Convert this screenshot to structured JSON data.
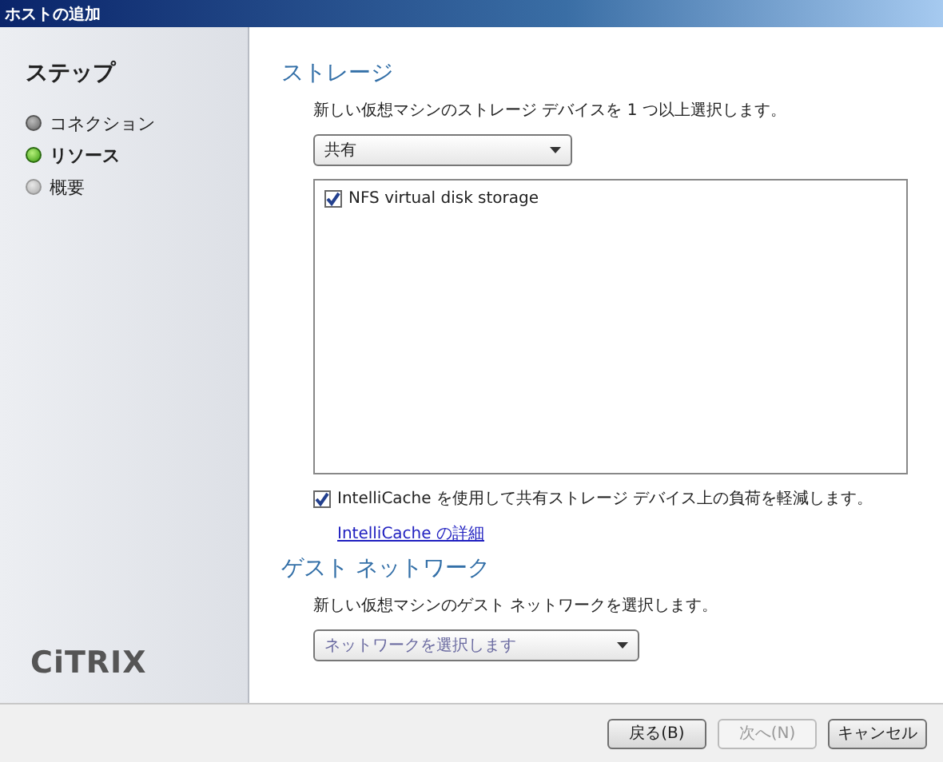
{
  "window": {
    "title": "ホストの追加"
  },
  "sidebar": {
    "heading": "ステップ",
    "steps": [
      {
        "label": "コネクション",
        "kind": "done"
      },
      {
        "label": "リソース",
        "kind": "current"
      },
      {
        "label": "概要",
        "kind": "pending"
      }
    ],
    "logo": "CiTRIX"
  },
  "storage": {
    "heading": "ストレージ",
    "description": "新しい仮想マシンのストレージ デバイスを 1 つ以上選択します。",
    "dropdown": {
      "value": "共有"
    },
    "items": [
      {
        "label": "NFS virtual disk storage",
        "checked": true
      }
    ],
    "intellicache": {
      "label": "IntelliCache を使用して共有ストレージ デバイス上の負荷を軽減します。",
      "checked": true
    },
    "link": "IntelliCache の詳細"
  },
  "network": {
    "heading": "ゲスト ネットワーク",
    "description": "新しい仮想マシンのゲスト ネットワークを選択します。",
    "dropdown": {
      "placeholder": "ネットワークを選択します"
    }
  },
  "buttons": [
    {
      "label": "戻る(B)",
      "disabled": false
    },
    {
      "label": "次へ(N)",
      "disabled": true
    },
    {
      "label": "キャンセル",
      "disabled": false
    }
  ]
}
